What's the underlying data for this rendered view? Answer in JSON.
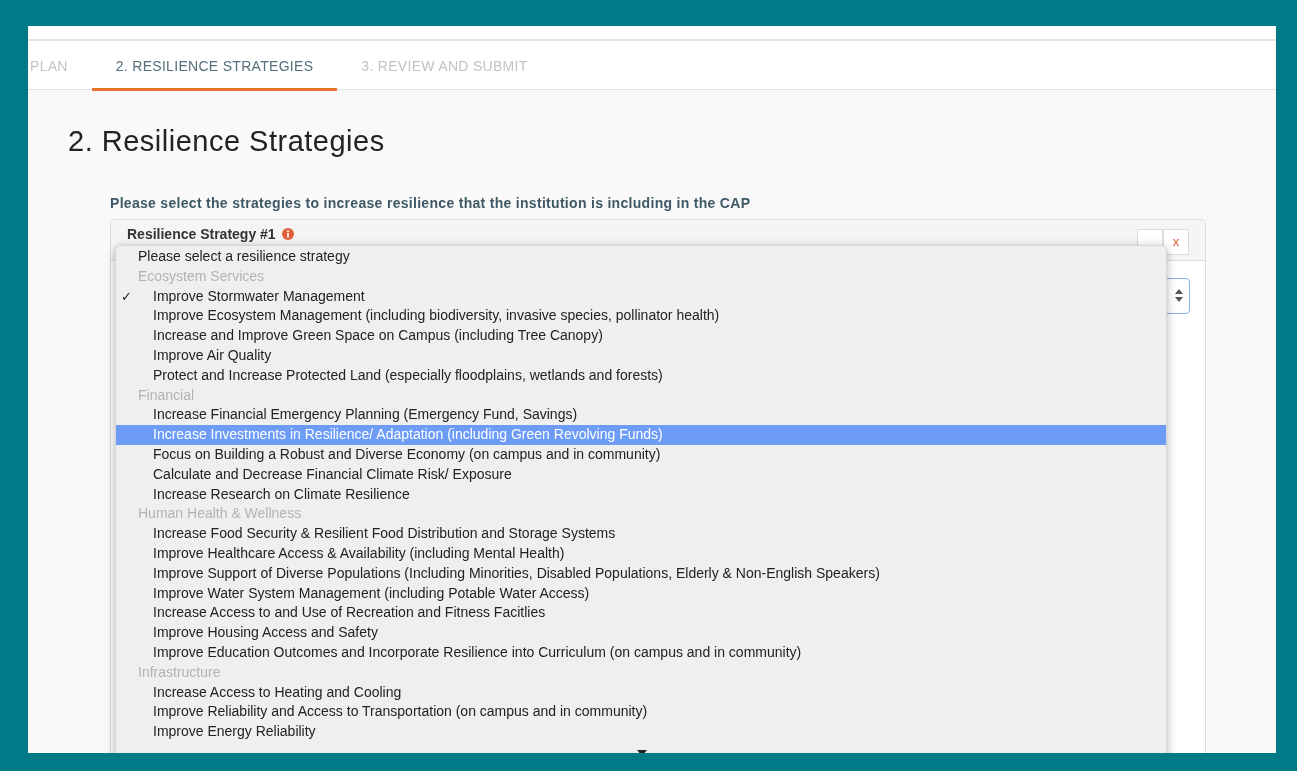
{
  "tabs": [
    {
      "label": "PLAN",
      "selected": false
    },
    {
      "label": "2. RESILIENCE STRATEGIES",
      "selected": true
    },
    {
      "label": "3. REVIEW AND SUBMIT",
      "selected": false
    }
  ],
  "heading": "2. Resilience Strategies",
  "prompt": "Please select the strategies to increase resilience that the institution is including in the CAP",
  "strategy_panel": {
    "title": "Resilience Strategy #1",
    "remove_button": "x"
  },
  "dropdown": {
    "check_mark": "✓",
    "items": [
      {
        "kind": "placeholder",
        "label": "Please select a resilience strategy",
        "checked": false,
        "selected": false
      },
      {
        "kind": "group",
        "label": "Ecosystem Services"
      },
      {
        "kind": "option",
        "label": "Improve Stormwater Management",
        "checked": true,
        "selected": false
      },
      {
        "kind": "option",
        "label": "Improve Ecosystem Management (including biodiversity, invasive species, pollinator health)",
        "checked": false,
        "selected": false
      },
      {
        "kind": "option",
        "label": "Increase and Improve Green Space on Campus (including Tree Canopy)",
        "checked": false,
        "selected": false
      },
      {
        "kind": "option",
        "label": "Improve Air Quality",
        "checked": false,
        "selected": false
      },
      {
        "kind": "option",
        "label": "Protect and Increase Protected Land (especially floodplains, wetlands and forests)",
        "checked": false,
        "selected": false
      },
      {
        "kind": "group",
        "label": "Financial"
      },
      {
        "kind": "option",
        "label": "Increase Financial Emergency Planning (Emergency Fund, Savings)",
        "checked": false,
        "selected": false
      },
      {
        "kind": "option",
        "label": "Increase Investments in Resilience/ Adaptation (including Green Revolving Funds)",
        "checked": false,
        "selected": true
      },
      {
        "kind": "option",
        "label": "Focus on Building a Robust and Diverse Economy (on campus and in community)",
        "checked": false,
        "selected": false
      },
      {
        "kind": "option",
        "label": "Calculate and Decrease Financial Climate Risk/ Exposure",
        "checked": false,
        "selected": false
      },
      {
        "kind": "option",
        "label": "Increase Research on Climate Resilience",
        "checked": false,
        "selected": false
      },
      {
        "kind": "group",
        "label": "Human Health & Wellness"
      },
      {
        "kind": "option",
        "label": "Increase Food Security & Resilient Food Distribution and Storage Systems",
        "checked": false,
        "selected": false
      },
      {
        "kind": "option",
        "label": "Improve Healthcare Access & Availability (including Mental Health)",
        "checked": false,
        "selected": false
      },
      {
        "kind": "option",
        "label": "Improve Support of Diverse Populations (Including Minorities, Disabled Populations, Elderly & Non-English Speakers)",
        "checked": false,
        "selected": false
      },
      {
        "kind": "option",
        "label": "Improve Water System Management (including Potable Water Access)",
        "checked": false,
        "selected": false
      },
      {
        "kind": "option",
        "label": "Increase Access to and Use of Recreation and Fitness Facitlies",
        "checked": false,
        "selected": false
      },
      {
        "kind": "option",
        "label": "Improve Housing Access and Safety",
        "checked": false,
        "selected": false
      },
      {
        "kind": "option",
        "label": "Improve Education Outcomes and Incorporate Resilience into Curriculum (on campus and in community)",
        "checked": false,
        "selected": false
      },
      {
        "kind": "group",
        "label": "Infrastructure"
      },
      {
        "kind": "option",
        "label": "Increase Access to Heating and Cooling",
        "checked": false,
        "selected": false
      },
      {
        "kind": "option",
        "label": "Improve Reliability and Access to Transportation (on campus and in community)",
        "checked": false,
        "selected": false
      },
      {
        "kind": "option",
        "label": "Improve Energy Reliability",
        "checked": false,
        "selected": false
      }
    ]
  }
}
